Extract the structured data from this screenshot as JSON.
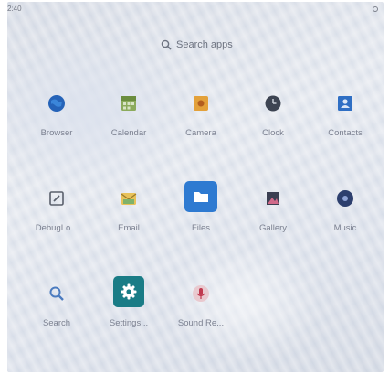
{
  "status_bar": {
    "time": "2:40"
  },
  "search": {
    "placeholder": "Search apps"
  },
  "apps": [
    {
      "label": "Browser",
      "icon": "globe-icon"
    },
    {
      "label": "Calendar",
      "icon": "calendar-icon"
    },
    {
      "label": "Camera",
      "icon": "camera-icon"
    },
    {
      "label": "Clock",
      "icon": "clock-icon"
    },
    {
      "label": "Contacts",
      "icon": "contacts-icon"
    },
    {
      "label": "DebugLo...",
      "icon": "debug-log-icon"
    },
    {
      "label": "Email",
      "icon": "email-icon"
    },
    {
      "label": "Files",
      "icon": "folder-icon"
    },
    {
      "label": "Gallery",
      "icon": "gallery-icon"
    },
    {
      "label": "Music",
      "icon": "music-icon"
    },
    {
      "label": "Search",
      "icon": "magnifier-icon"
    },
    {
      "label": "Settings...",
      "icon": "gear-icon"
    },
    {
      "label": "Sound Re...",
      "icon": "microphone-icon"
    }
  ],
  "colors": {
    "accent_blue": "#2e7ad1",
    "settings_teal": "#1a7c86",
    "label_gray": "#7b8090"
  }
}
